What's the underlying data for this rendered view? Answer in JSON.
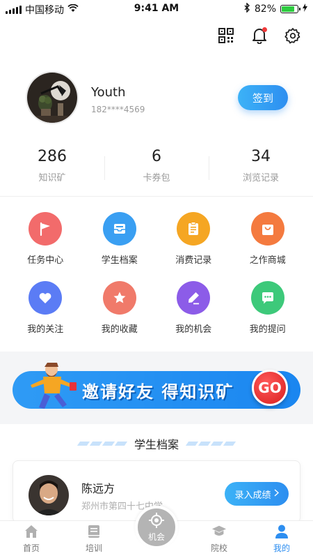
{
  "status_bar": {
    "carrier": "中国移动",
    "time": "9:41 AM",
    "battery": "82%",
    "battery_level": 0.82
  },
  "top_actions": {
    "icons": [
      "qr-code-icon",
      "bell-icon",
      "gear-icon"
    ]
  },
  "profile": {
    "name": "Youth",
    "phone": "182****4569",
    "signin_label": "签到"
  },
  "stats": [
    {
      "value": "286",
      "label": "知识矿"
    },
    {
      "value": "6",
      "label": "卡券包"
    },
    {
      "value": "34",
      "label": "浏览记录"
    }
  ],
  "grid": [
    {
      "label": "任务中心",
      "icon": "flag-icon",
      "color": "#f26b6b"
    },
    {
      "label": "学生档案",
      "icon": "inbox-icon",
      "color": "#3a9ff2"
    },
    {
      "label": "消费记录",
      "icon": "clipboard-icon",
      "color": "#f5a623"
    },
    {
      "label": "之作商城",
      "icon": "shopping-bag-icon",
      "color": "#f47a3f"
    },
    {
      "label": "我的关注",
      "icon": "heart-icon",
      "color": "#5b7cf5"
    },
    {
      "label": "我的收藏",
      "icon": "star-icon",
      "color": "#f07a6a"
    },
    {
      "label": "我的机会",
      "icon": "pen-icon",
      "color": "#8c5ce8"
    },
    {
      "label": "我的提问",
      "icon": "chat-icon",
      "color": "#3dc97a"
    }
  ],
  "banner": {
    "text": "邀请好友 得知识矿",
    "go_label": "GO"
  },
  "section": {
    "title": "学生档案"
  },
  "student": {
    "name": "陈远方",
    "school": "郑州市第四十七中学",
    "button_label": "录入成绩"
  },
  "tabbar": [
    {
      "label": "首页",
      "icon": "home-icon"
    },
    {
      "label": "培训",
      "icon": "book-icon"
    },
    {
      "label": "机会",
      "icon": "target-icon"
    },
    {
      "label": "院校",
      "icon": "graduation-cap-icon"
    },
    {
      "label": "我的",
      "icon": "user-icon"
    }
  ],
  "colors": {
    "accent": "#2d8ef0",
    "tab_active": "#2d8ef0"
  }
}
